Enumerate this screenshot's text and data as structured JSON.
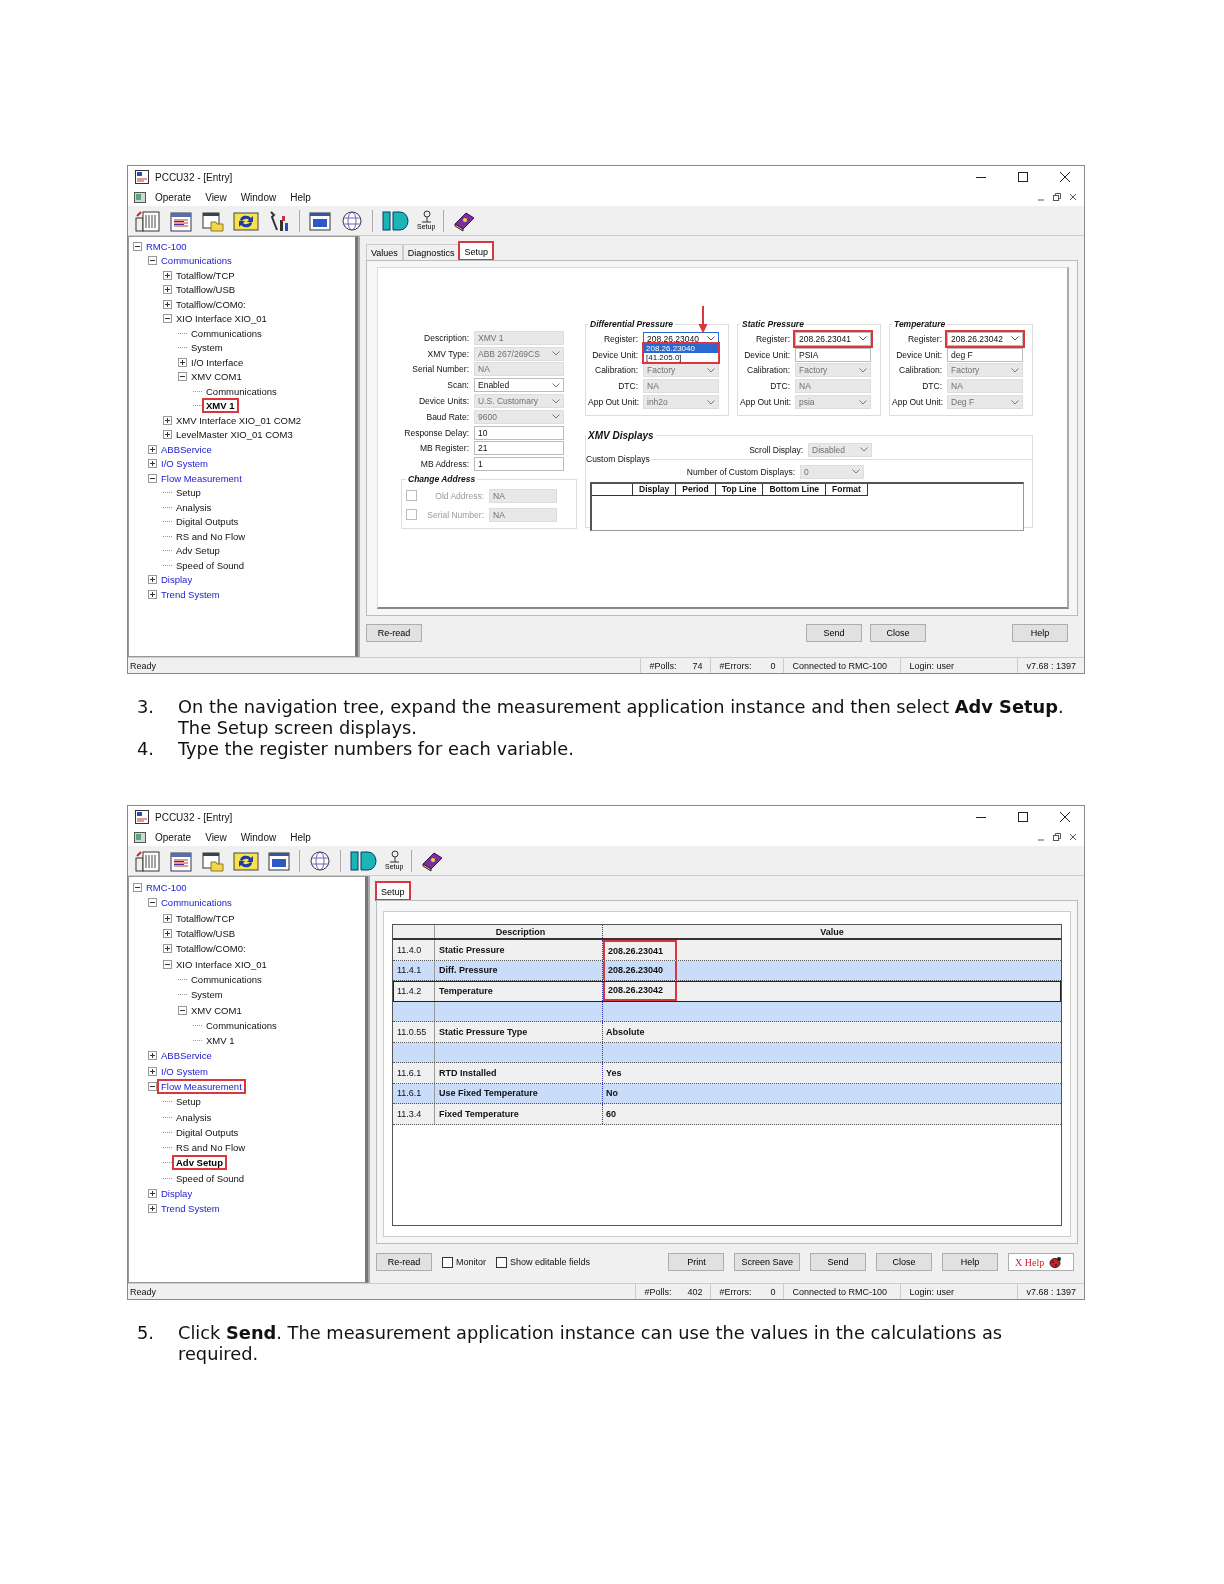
{
  "screenshot_1": {
    "window": {
      "title": "PCCU32 - [Entry]"
    },
    "menu": [
      "Operate",
      "View",
      "Window",
      "Help"
    ],
    "toolbar": [
      {
        "kind": "device"
      },
      {
        "kind": "entry"
      },
      {
        "kind": "collect"
      },
      {
        "kind": "refresh"
      },
      {
        "kind": "tools"
      },
      {
        "kind": "mb"
      },
      {
        "kind": "globe"
      },
      {
        "kind": "id"
      },
      {
        "kind": "setup",
        "label": "Setup"
      },
      {
        "kind": "book"
      }
    ],
    "tree": [
      {
        "label": "RMC-100",
        "expanded": true,
        "selected": false,
        "highlighted": false,
        "children": [
          {
            "label": "Communications",
            "expanded": true,
            "selected": false,
            "highlighted": false,
            "children": [
              {
                "label": "Totalflow/TCP",
                "expanded": false,
                "selected": false,
                "highlighted": false
              },
              {
                "label": "Totalflow/USB",
                "expanded": false,
                "selected": false,
                "highlighted": false
              },
              {
                "label": "Totalflow/COM0:",
                "expanded": false,
                "selected": false,
                "highlighted": false
              },
              {
                "label": "XIO Interface XIO_01",
                "expanded": true,
                "selected": false,
                "highlighted": false,
                "children": [
                  {
                    "label": "Communications",
                    "selected": false,
                    "highlighted": false
                  },
                  {
                    "label": "System",
                    "selected": false,
                    "highlighted": false
                  },
                  {
                    "label": "I/O Interface",
                    "expanded": false,
                    "selected": false,
                    "highlighted": false
                  },
                  {
                    "label": "XMV COM1",
                    "expanded": true,
                    "selected": false,
                    "highlighted": false,
                    "children": [
                      {
                        "label": "Communications",
                        "selected": false,
                        "highlighted": false
                      },
                      {
                        "label": "XMV 1",
                        "selected": true,
                        "highlighted": true
                      }
                    ]
                  }
                ]
              },
              {
                "label": "XMV Interface XIO_01 COM2",
                "expanded": false,
                "selected": false,
                "highlighted": false
              },
              {
                "label": "LevelMaster XIO_01 COM3",
                "expanded": false,
                "selected": false,
                "highlighted": false
              }
            ]
          },
          {
            "label": "ABBService",
            "expanded": false,
            "selected": false,
            "highlighted": false
          },
          {
            "label": "I/O System",
            "expanded": false,
            "selected": false,
            "highlighted": false
          },
          {
            "label": "Flow Measurement",
            "expanded": true,
            "selected": false,
            "highlighted": false,
            "children": [
              {
                "label": "Setup",
                "selected": false,
                "highlighted": false
              },
              {
                "label": "Analysis",
                "selected": false,
                "highlighted": false
              },
              {
                "label": "Digital Outputs",
                "selected": false,
                "highlighted": false
              },
              {
                "label": "RS and No Flow",
                "selected": false,
                "highlighted": false
              },
              {
                "label": "Adv Setup",
                "selected": false,
                "highlighted": false
              },
              {
                "label": "Speed of Sound",
                "selected": false,
                "highlighted": false
              }
            ]
          },
          {
            "label": "Display",
            "expanded": false,
            "selected": false,
            "highlighted": false
          },
          {
            "label": "Trend System",
            "expanded": false,
            "selected": false,
            "highlighted": false
          }
        ]
      }
    ],
    "tabs": [
      {
        "label": "Values",
        "selected": false,
        "highlighted": false
      },
      {
        "label": "Diagnostics",
        "selected": false,
        "highlighted": false
      },
      {
        "label": "Setup",
        "selected": true,
        "highlighted": true
      }
    ],
    "device_fields": [
      {
        "label": "Description:",
        "value": "XMV 1",
        "kind": "text",
        "disabled": true
      },
      {
        "label": "XMV Type:",
        "value": "ABB 267/269CS",
        "kind": "dropdown",
        "disabled": true
      },
      {
        "label": "Serial Number:",
        "value": "NA",
        "kind": "text",
        "disabled": true
      },
      {
        "label": "Scan:",
        "value": "Enabled",
        "kind": "dropdown",
        "disabled": false
      },
      {
        "label": "Device Units:",
        "value": "U.S. Customary",
        "kind": "dropdown",
        "disabled": true
      },
      {
        "label": "Baud Rate:",
        "value": "9600",
        "kind": "dropdown",
        "disabled": true
      },
      {
        "label": "Response Delay:",
        "value": "10",
        "kind": "text",
        "disabled": false
      },
      {
        "label": "MB Register:",
        "value": "21",
        "kind": "text",
        "disabled": false
      },
      {
        "label": "MB Address:",
        "value": "1",
        "kind": "text",
        "disabled": false
      }
    ],
    "change_address": {
      "title": "Change Address",
      "rows": [
        {
          "label": "Old Address:",
          "value": "NA",
          "checked": false
        },
        {
          "label": "Serial Number:",
          "value": "NA",
          "checked": false
        }
      ]
    },
    "variables": [
      {
        "title": "Differential Pressure",
        "register": {
          "label": "Register:",
          "value": "208.26.23040",
          "highlighted": false,
          "open": true,
          "options": [
            {
              "label": "208.26.23040",
              "selected": true
            },
            {
              "label": "[41.205.0]",
              "selected": false
            }
          ]
        },
        "fields": [
          {
            "label": "Device Unit:",
            "kind": "text"
          },
          {
            "label": "Calibration:",
            "value": "Factory",
            "kind": "dropdown",
            "disabled": true
          },
          {
            "label": "DTC:",
            "value": "NA",
            "kind": "text",
            "disabled": true
          },
          {
            "label": "App Out Unit:",
            "value": "inh2o",
            "kind": "dropdown",
            "disabled": true
          }
        ]
      },
      {
        "title": "Static Pressure",
        "register": {
          "label": "Register:",
          "value": "208.26.23041",
          "highlighted": true,
          "open": false
        },
        "fields": [
          {
            "label": "Device Unit:",
            "value": "PSIA",
            "kind": "text",
            "disabled": false
          },
          {
            "label": "Calibration:",
            "value": "Factory",
            "kind": "dropdown",
            "disabled": true
          },
          {
            "label": "DTC:",
            "value": "NA",
            "kind": "text",
            "disabled": true
          },
          {
            "label": "App Out Unit:",
            "value": "psia",
            "kind": "dropdown",
            "disabled": true
          }
        ]
      },
      {
        "title": "Temperature",
        "register": {
          "label": "Register:",
          "value": "208.26.23042",
          "highlighted": true,
          "open": false
        },
        "fields": [
          {
            "label": "Device Unit:",
            "value": "deg F",
            "kind": "text",
            "disabled": false
          },
          {
            "label": "Calibration:",
            "value": "Factory",
            "kind": "dropdown",
            "disabled": true
          },
          {
            "label": "DTC:",
            "value": "NA",
            "kind": "text",
            "disabled": true
          },
          {
            "label": "App Out Unit:",
            "value": "Deg F",
            "kind": "dropdown",
            "disabled": true
          }
        ]
      }
    ],
    "xmv_displays": {
      "title": "XMV Displays",
      "scroll_display": {
        "label": "Scroll Display:",
        "value": "Disabled",
        "disabled": true
      },
      "custom_title": "Custom Displays",
      "count": {
        "label": "Number of Custom Displays:",
        "value": "0",
        "disabled": true
      },
      "columns": [
        "Display",
        "Period",
        "Top Line",
        "Bottom Line",
        "Format"
      ]
    },
    "left_buttons": [
      "Re-read"
    ],
    "action_buttons": [
      "Send",
      "Close"
    ],
    "help_button": "Help",
    "status_bar": {
      "text": "Ready",
      "polls_label": "#Polls:",
      "polls": "74",
      "errors_label": "#Errors:",
      "errors": "0",
      "connection": "Connected to RMC-100",
      "login": "Login: user",
      "version": "v7.68 : 1397"
    }
  },
  "steps_1": [
    {
      "number": "3.",
      "text": "On the navigation tree, expand the measurement application instance and then select **Adv Setup**. The Setup screen displays."
    },
    {
      "number": "4.",
      "text": "Type the register numbers for each variable."
    }
  ],
  "screenshot_2": {
    "window": {
      "title": "PCCU32 - [Entry]"
    },
    "menu": [
      "Operate",
      "View",
      "Window",
      "Help"
    ],
    "toolbar": [
      {
        "kind": "device"
      },
      {
        "kind": "entry"
      },
      {
        "kind": "collect"
      },
      {
        "kind": "refresh"
      },
      {
        "kind": "mb"
      },
      {
        "kind": "globe"
      },
      {
        "kind": "id"
      },
      {
        "kind": "setup",
        "label": "Setup"
      },
      {
        "kind": "book"
      }
    ],
    "tree": [
      {
        "label": "RMC-100",
        "expanded": true,
        "selected": false,
        "highlighted": false,
        "children": [
          {
            "label": "Communications",
            "expanded": true,
            "selected": false,
            "highlighted": false,
            "children": [
              {
                "label": "Totalflow/TCP",
                "expanded": false,
                "selected": false,
                "highlighted": false
              },
              {
                "label": "Totalflow/USB",
                "expanded": false,
                "selected": false,
                "highlighted": false
              },
              {
                "label": "Totalflow/COM0:",
                "expanded": false,
                "selected": false,
                "highlighted": false
              },
              {
                "label": "XIO Interface XIO_01",
                "expanded": true,
                "selected": false,
                "highlighted": false,
                "children": [
                  {
                    "label": "Communications",
                    "selected": false,
                    "highlighted": false
                  },
                  {
                    "label": "System",
                    "selected": false,
                    "highlighted": false
                  },
                  {
                    "label": "XMV COM1",
                    "expanded": true,
                    "selected": false,
                    "highlighted": false,
                    "children": [
                      {
                        "label": "Communications",
                        "selected": false,
                        "highlighted": false
                      },
                      {
                        "label": "XMV 1",
                        "selected": false,
                        "highlighted": false
                      }
                    ]
                  }
                ]
              }
            ]
          },
          {
            "label": "ABBService",
            "expanded": false,
            "selected": false,
            "highlighted": false
          },
          {
            "label": "I/O System",
            "expanded": false,
            "selected": false,
            "highlighted": false
          },
          {
            "label": "Flow Measurement",
            "expanded": true,
            "selected": false,
            "highlighted": true,
            "children": [
              {
                "label": "Setup",
                "selected": false,
                "highlighted": false
              },
              {
                "label": "Analysis",
                "selected": false,
                "highlighted": false
              },
              {
                "label": "Digital Outputs",
                "selected": false,
                "highlighted": false
              },
              {
                "label": "RS and No Flow",
                "selected": false,
                "highlighted": false
              },
              {
                "label": "Adv Setup",
                "selected": true,
                "highlighted": true
              },
              {
                "label": "Speed of Sound",
                "selected": false,
                "highlighted": false
              }
            ]
          },
          {
            "label": "Display",
            "expanded": false,
            "selected": false,
            "highlighted": false
          },
          {
            "label": "Trend System",
            "expanded": false,
            "selected": false,
            "highlighted": false
          }
        ]
      }
    ],
    "tabs": [
      {
        "label": "Setup",
        "selected": true,
        "highlighted": true
      }
    ],
    "table": {
      "columns": [
        "Description",
        "Value"
      ],
      "rows": [
        {
          "id": "11.4.0",
          "description": "Static Pressure",
          "value": "208.26.23041",
          "selected": false,
          "highlighted": true
        },
        {
          "id": "11.4.1",
          "description": "Diff. Pressure",
          "value": "208.26.23040",
          "selected": false,
          "highlighted": true
        },
        {
          "id": "11.4.2",
          "description": "Temperature",
          "value": "208.26.23042",
          "selected": true,
          "highlighted": true
        },
        {
          "selected": false,
          "highlighted": false
        },
        {
          "id": "11.0.55",
          "description": "Static Pressure Type",
          "value": "Absolute",
          "selected": false,
          "highlighted": false
        },
        {
          "selected": false,
          "highlighted": false
        },
        {
          "id": "11.6.1",
          "description": "RTD Installed",
          "value": "Yes",
          "selected": false,
          "highlighted": false
        },
        {
          "id": "11.6.1",
          "description": "Use Fixed Temperature",
          "value": "No",
          "selected": false,
          "highlighted": false
        },
        {
          "id": "11.3.4",
          "description": "Fixed Temperature",
          "value": "60",
          "selected": false,
          "highlighted": false
        }
      ]
    },
    "left_buttons": [
      "Re-read"
    ],
    "checkboxes": [
      {
        "label": "Monitor",
        "checked": false
      },
      {
        "label": "Show editable fields",
        "checked": false
      }
    ],
    "action_buttons": [
      "Print",
      "Screen Save",
      "Send",
      "Close",
      "Help"
    ],
    "xhelp_button": "X Help",
    "status_bar": {
      "text": "Ready",
      "polls_label": "#Polls:",
      "polls": "402",
      "errors_label": "#Errors:",
      "errors": "0",
      "connection": "Connected to RMC-100",
      "login": "Login: user",
      "version": "v7.68 : 1397"
    }
  },
  "steps_2": [
    {
      "number": "5.",
      "text": "Click **Send**. The measurement application instance can use the values in the calculations as required."
    }
  ]
}
